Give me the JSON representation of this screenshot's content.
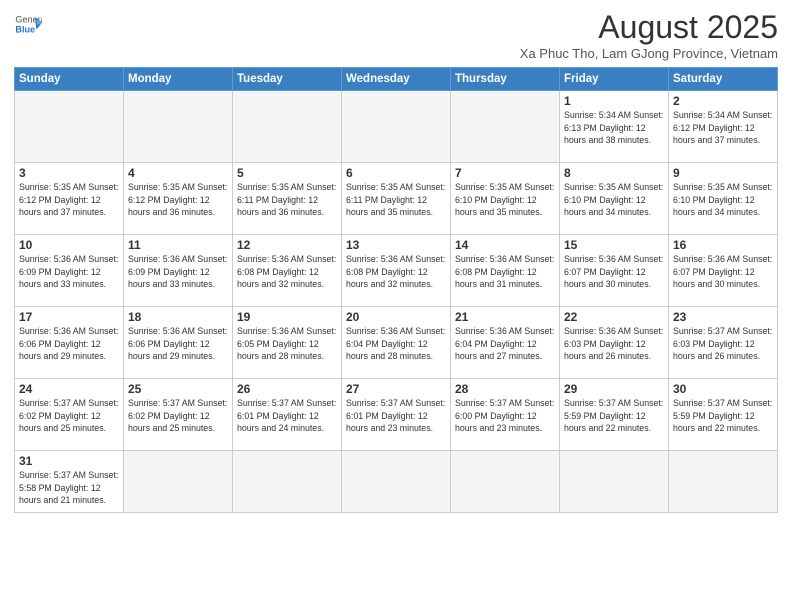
{
  "header": {
    "logo_general": "General",
    "logo_blue": "Blue",
    "main_title": "August 2025",
    "subtitle": "Xa Phuc Tho, Lam GJong Province, Vietnam"
  },
  "days_of_week": [
    "Sunday",
    "Monday",
    "Tuesday",
    "Wednesday",
    "Thursday",
    "Friday",
    "Saturday"
  ],
  "weeks": [
    [
      {
        "day": "",
        "info": ""
      },
      {
        "day": "",
        "info": ""
      },
      {
        "day": "",
        "info": ""
      },
      {
        "day": "",
        "info": ""
      },
      {
        "day": "",
        "info": ""
      },
      {
        "day": "1",
        "info": "Sunrise: 5:34 AM\nSunset: 6:13 PM\nDaylight: 12 hours\nand 38 minutes."
      },
      {
        "day": "2",
        "info": "Sunrise: 5:34 AM\nSunset: 6:12 PM\nDaylight: 12 hours\nand 37 minutes."
      }
    ],
    [
      {
        "day": "3",
        "info": "Sunrise: 5:35 AM\nSunset: 6:12 PM\nDaylight: 12 hours\nand 37 minutes."
      },
      {
        "day": "4",
        "info": "Sunrise: 5:35 AM\nSunset: 6:12 PM\nDaylight: 12 hours\nand 36 minutes."
      },
      {
        "day": "5",
        "info": "Sunrise: 5:35 AM\nSunset: 6:11 PM\nDaylight: 12 hours\nand 36 minutes."
      },
      {
        "day": "6",
        "info": "Sunrise: 5:35 AM\nSunset: 6:11 PM\nDaylight: 12 hours\nand 35 minutes."
      },
      {
        "day": "7",
        "info": "Sunrise: 5:35 AM\nSunset: 6:10 PM\nDaylight: 12 hours\nand 35 minutes."
      },
      {
        "day": "8",
        "info": "Sunrise: 5:35 AM\nSunset: 6:10 PM\nDaylight: 12 hours\nand 34 minutes."
      },
      {
        "day": "9",
        "info": "Sunrise: 5:35 AM\nSunset: 6:10 PM\nDaylight: 12 hours\nand 34 minutes."
      }
    ],
    [
      {
        "day": "10",
        "info": "Sunrise: 5:36 AM\nSunset: 6:09 PM\nDaylight: 12 hours\nand 33 minutes."
      },
      {
        "day": "11",
        "info": "Sunrise: 5:36 AM\nSunset: 6:09 PM\nDaylight: 12 hours\nand 33 minutes."
      },
      {
        "day": "12",
        "info": "Sunrise: 5:36 AM\nSunset: 6:08 PM\nDaylight: 12 hours\nand 32 minutes."
      },
      {
        "day": "13",
        "info": "Sunrise: 5:36 AM\nSunset: 6:08 PM\nDaylight: 12 hours\nand 32 minutes."
      },
      {
        "day": "14",
        "info": "Sunrise: 5:36 AM\nSunset: 6:08 PM\nDaylight: 12 hours\nand 31 minutes."
      },
      {
        "day": "15",
        "info": "Sunrise: 5:36 AM\nSunset: 6:07 PM\nDaylight: 12 hours\nand 30 minutes."
      },
      {
        "day": "16",
        "info": "Sunrise: 5:36 AM\nSunset: 6:07 PM\nDaylight: 12 hours\nand 30 minutes."
      }
    ],
    [
      {
        "day": "17",
        "info": "Sunrise: 5:36 AM\nSunset: 6:06 PM\nDaylight: 12 hours\nand 29 minutes."
      },
      {
        "day": "18",
        "info": "Sunrise: 5:36 AM\nSunset: 6:06 PM\nDaylight: 12 hours\nand 29 minutes."
      },
      {
        "day": "19",
        "info": "Sunrise: 5:36 AM\nSunset: 6:05 PM\nDaylight: 12 hours\nand 28 minutes."
      },
      {
        "day": "20",
        "info": "Sunrise: 5:36 AM\nSunset: 6:04 PM\nDaylight: 12 hours\nand 28 minutes."
      },
      {
        "day": "21",
        "info": "Sunrise: 5:36 AM\nSunset: 6:04 PM\nDaylight: 12 hours\nand 27 minutes."
      },
      {
        "day": "22",
        "info": "Sunrise: 5:36 AM\nSunset: 6:03 PM\nDaylight: 12 hours\nand 26 minutes."
      },
      {
        "day": "23",
        "info": "Sunrise: 5:37 AM\nSunset: 6:03 PM\nDaylight: 12 hours\nand 26 minutes."
      }
    ],
    [
      {
        "day": "24",
        "info": "Sunrise: 5:37 AM\nSunset: 6:02 PM\nDaylight: 12 hours\nand 25 minutes."
      },
      {
        "day": "25",
        "info": "Sunrise: 5:37 AM\nSunset: 6:02 PM\nDaylight: 12 hours\nand 25 minutes."
      },
      {
        "day": "26",
        "info": "Sunrise: 5:37 AM\nSunset: 6:01 PM\nDaylight: 12 hours\nand 24 minutes."
      },
      {
        "day": "27",
        "info": "Sunrise: 5:37 AM\nSunset: 6:01 PM\nDaylight: 12 hours\nand 23 minutes."
      },
      {
        "day": "28",
        "info": "Sunrise: 5:37 AM\nSunset: 6:00 PM\nDaylight: 12 hours\nand 23 minutes."
      },
      {
        "day": "29",
        "info": "Sunrise: 5:37 AM\nSunset: 5:59 PM\nDaylight: 12 hours\nand 22 minutes."
      },
      {
        "day": "30",
        "info": "Sunrise: 5:37 AM\nSunset: 5:59 PM\nDaylight: 12 hours\nand 22 minutes."
      }
    ],
    [
      {
        "day": "31",
        "info": "Sunrise: 5:37 AM\nSunset: 5:58 PM\nDaylight: 12 hours\nand 21 minutes."
      },
      {
        "day": "",
        "info": ""
      },
      {
        "day": "",
        "info": ""
      },
      {
        "day": "",
        "info": ""
      },
      {
        "day": "",
        "info": ""
      },
      {
        "day": "",
        "info": ""
      },
      {
        "day": "",
        "info": ""
      }
    ]
  ]
}
